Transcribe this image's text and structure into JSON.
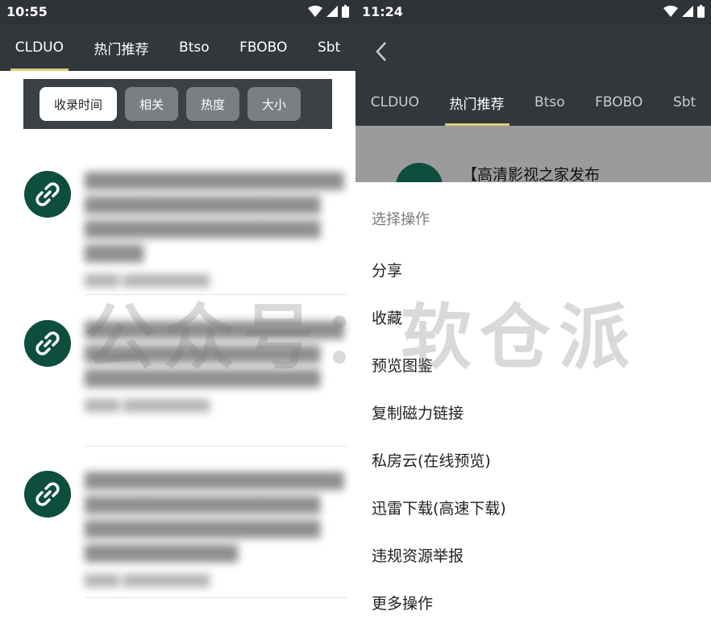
{
  "left": {
    "status": {
      "time": "10:55"
    },
    "tabs": [
      "CLDUO",
      "热门推荐",
      "Btso",
      "FBOBO",
      "Sbt"
    ],
    "active_tab": "CLDUO",
    "filters": [
      "收录时间",
      "相关",
      "热度",
      "大小"
    ],
    "active_filter": "收录时间"
  },
  "right": {
    "status": {
      "time": "11:24"
    },
    "tabs": [
      "CLDUO",
      "热门推荐",
      "Btso",
      "FBOBO",
      "Sbt"
    ],
    "active_tab": "热门推荐",
    "dimmed_item_title": "【高清影视之家发布",
    "sheet": {
      "title": "选择操作",
      "items": [
        "分享",
        "收藏",
        "预览图鉴",
        "复制磁力链接",
        "私房云(在线预览)",
        "迅雷下载(高速下载)",
        "违规资源举报",
        "更多操作"
      ]
    }
  },
  "watermark": "公众号：软仓派",
  "icons": {
    "avatar": "link-icon",
    "back": "back-arrow-icon",
    "wifi": "wifi-icon",
    "signal": "signal-icon",
    "battery": "battery-icon"
  },
  "colors": {
    "toolbar": "#32373c",
    "accent_underline": "#d8cf7a",
    "avatar": "#0d4e3f"
  }
}
